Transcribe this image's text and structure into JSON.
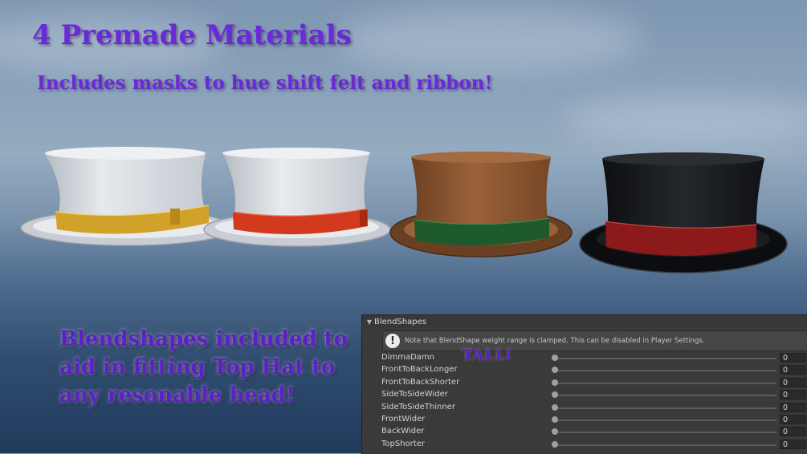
{
  "headline": "4 Premade Materials",
  "subheadline": "Includes masks to hue shift felt and ribbon!",
  "blendshapes_note": "Blendshapes included to aid in fitting Top Hat to any resonable head!",
  "tall_label": "TALL!",
  "hats": [
    {
      "felt_color": "#d9dde2",
      "ribbon_color": "#d1a22a"
    },
    {
      "felt_color": "#d9dde2",
      "ribbon_color": "#d23a1e"
    },
    {
      "felt_color": "#8a5530",
      "ribbon_color": "#1f5a2c"
    },
    {
      "felt_color": "#17191d",
      "ribbon_color": "#8c1a1a"
    }
  ],
  "inspector": {
    "section_title": "BlendShapes",
    "foldout_icon": "triangle-down-icon",
    "warning_icon": "exclamation-circle-icon",
    "note": "Note that BlendShape weight range is clamped. This can be disabled in Player Settings.",
    "rows": [
      {
        "label": "DimmaDamn",
        "value": "0"
      },
      {
        "label": "FrontToBackLonger",
        "value": "0"
      },
      {
        "label": "FrontToBackShorter",
        "value": "0"
      },
      {
        "label": "SideToSideWider",
        "value": "0"
      },
      {
        "label": "SideToSideThinner",
        "value": "0"
      },
      {
        "label": "FrontWider",
        "value": "0"
      },
      {
        "label": "BackWider",
        "value": "0"
      },
      {
        "label": "TopShorter",
        "value": "0"
      }
    ]
  },
  "colors": {
    "heading_purple": "#6a2ad6",
    "panel_bg": "#3a3a3a"
  }
}
